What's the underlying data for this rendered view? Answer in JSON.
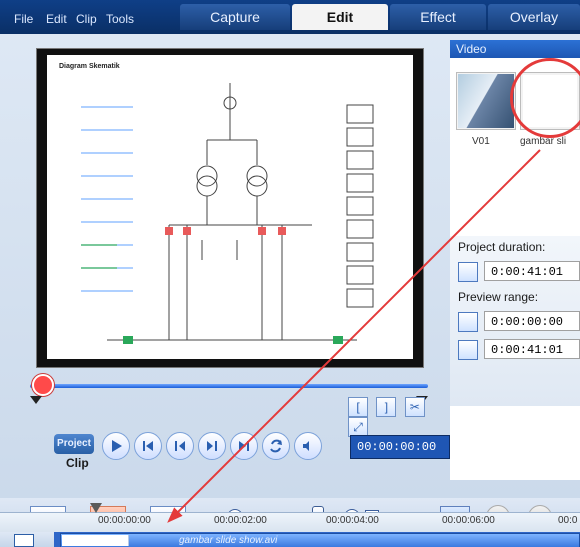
{
  "app": {
    "menus": [
      "File",
      "Edit",
      "Clip",
      "Tools"
    ],
    "tabs": [
      {
        "label": "Capture",
        "active": false
      },
      {
        "label": "Edit",
        "active": true
      },
      {
        "label": "Effect",
        "active": false
      },
      {
        "label": "Overlay",
        "active": false
      }
    ]
  },
  "preview": {
    "diagram_title": "Diagram Skematik",
    "project_clip_label": "Project",
    "clip_label": "Clip",
    "timecode": "00:00:00:00"
  },
  "library": {
    "header": "Video",
    "thumbnails": [
      {
        "label": "V01"
      },
      {
        "label": "gambar sli"
      }
    ]
  },
  "project_info": {
    "duration_label": "Project duration:",
    "duration_value": "0:00:41:01",
    "preview_range_label": "Preview range:",
    "preview_start": "0:00:00:00",
    "preview_end": "0:00:41:01"
  },
  "timeline": {
    "ticks": [
      "00:00:00:00",
      "00:00:02:00",
      "00:00:04:00",
      "00:00:06:00",
      "00:0"
    ],
    "clip_name": "gambar slide show.avi"
  },
  "colors": {
    "menu_bar": "#0f3f87",
    "highlight": "#e43a3a"
  }
}
